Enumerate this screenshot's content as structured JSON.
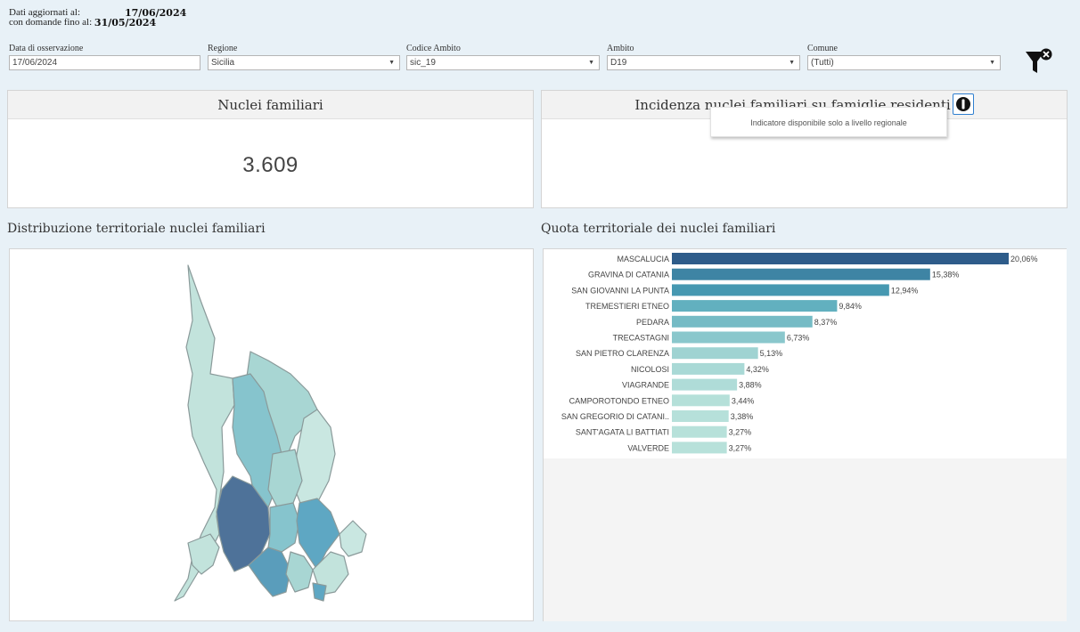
{
  "update_info": {
    "label1": "Dati aggiornati al:",
    "value1": "17/06/2024",
    "label2": "con domande fino al:",
    "value2": "31/05/2024"
  },
  "filters": [
    {
      "label": "Data di osservazione",
      "value": "17/06/2024",
      "dropdown": false
    },
    {
      "label": "Regione",
      "value": "Sicilia",
      "dropdown": true
    },
    {
      "label": "Codice Ambito",
      "value": "sic_19",
      "dropdown": true
    },
    {
      "label": "Ambito",
      "value": "D19",
      "dropdown": true
    },
    {
      "label": "Comune",
      "value": "(Tutti)",
      "dropdown": true
    }
  ],
  "arrow_glyph": "▼",
  "icons": {
    "filter": "clear-filter-icon",
    "info": "info-icon"
  },
  "kpi1": {
    "title": "Nuclei familiari",
    "value": "3.609"
  },
  "kpi2": {
    "title": "Incidenza nuclei familiari su famiglie residenti",
    "tooltip": "Indicatore disponibile solo a livello regionale"
  },
  "map_section": {
    "title": "Distribuzione territoriale nuclei familiari"
  },
  "chart_section": {
    "title": "Quota territoriale dei nuclei familiari"
  },
  "colors": {
    "bar_dark": "#2e5c8a",
    "bar_light": "#b7e1da",
    "map_dark": "#4a6f95"
  },
  "chart_data": {
    "type": "bar",
    "orientation": "horizontal",
    "categories": [
      "MASCALUCIA",
      "GRAVINA DI CATANIA",
      "SAN GIOVANNI LA PUNTA",
      "TREMESTIERI ETNEO",
      "PEDARA",
      "TRECASTAGNI",
      "SAN PIETRO CLARENZA",
      "NICOLOSI",
      "VIAGRANDE",
      "CAMPOROTONDO ETNEO",
      "SAN GREGORIO DI CATANI..",
      "SANT'AGATA LI BATTIATI",
      "VALVERDE"
    ],
    "values": [
      20.06,
      15.38,
      12.94,
      9.84,
      8.37,
      6.73,
      5.13,
      4.32,
      3.88,
      3.44,
      3.38,
      3.27,
      3.27
    ],
    "labels": [
      "20,06%",
      "15,38%",
      "12,94%",
      "9,84%",
      "8,37%",
      "6,73%",
      "5,13%",
      "4,32%",
      "3,88%",
      "3,44%",
      "3,38%",
      "3,27%",
      "3,27%"
    ],
    "title": "Quota territoriale dei nuclei familiari",
    "xlim": [
      0,
      20.06
    ]
  }
}
